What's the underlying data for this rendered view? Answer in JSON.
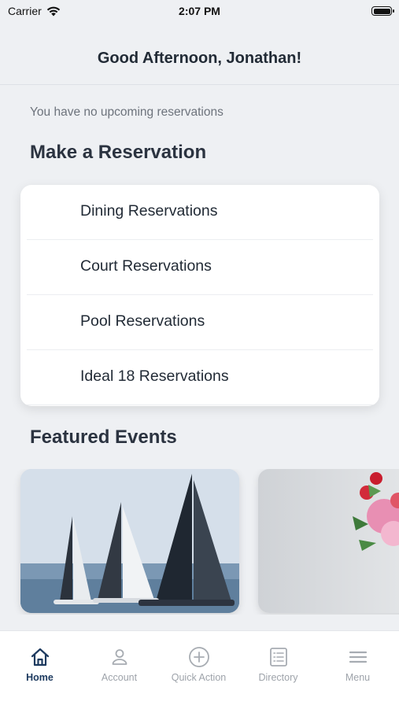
{
  "status_bar": {
    "carrier": "Carrier",
    "time": "2:07 PM"
  },
  "header": {
    "greeting": "Good Afternoon, Jonathan!"
  },
  "upcoming": {
    "message": "You have no upcoming reservations"
  },
  "reservations": {
    "title": "Make a Reservation",
    "items": [
      {
        "label": "Dining Reservations"
      },
      {
        "label": "Court Reservations"
      },
      {
        "label": "Pool Reservations"
      },
      {
        "label": "Ideal 18 Reservations"
      }
    ]
  },
  "events": {
    "title": "Featured Events"
  },
  "tab_bar": {
    "active_color": "#1d3a5f",
    "inactive_color": "#9ea3aa",
    "tabs": [
      {
        "label": "Home",
        "icon": "home-icon"
      },
      {
        "label": "Account",
        "icon": "account-icon"
      },
      {
        "label": "Quick Action",
        "icon": "plus-circle-icon"
      },
      {
        "label": "Directory",
        "icon": "directory-icon"
      },
      {
        "label": "Menu",
        "icon": "menu-icon"
      }
    ]
  }
}
